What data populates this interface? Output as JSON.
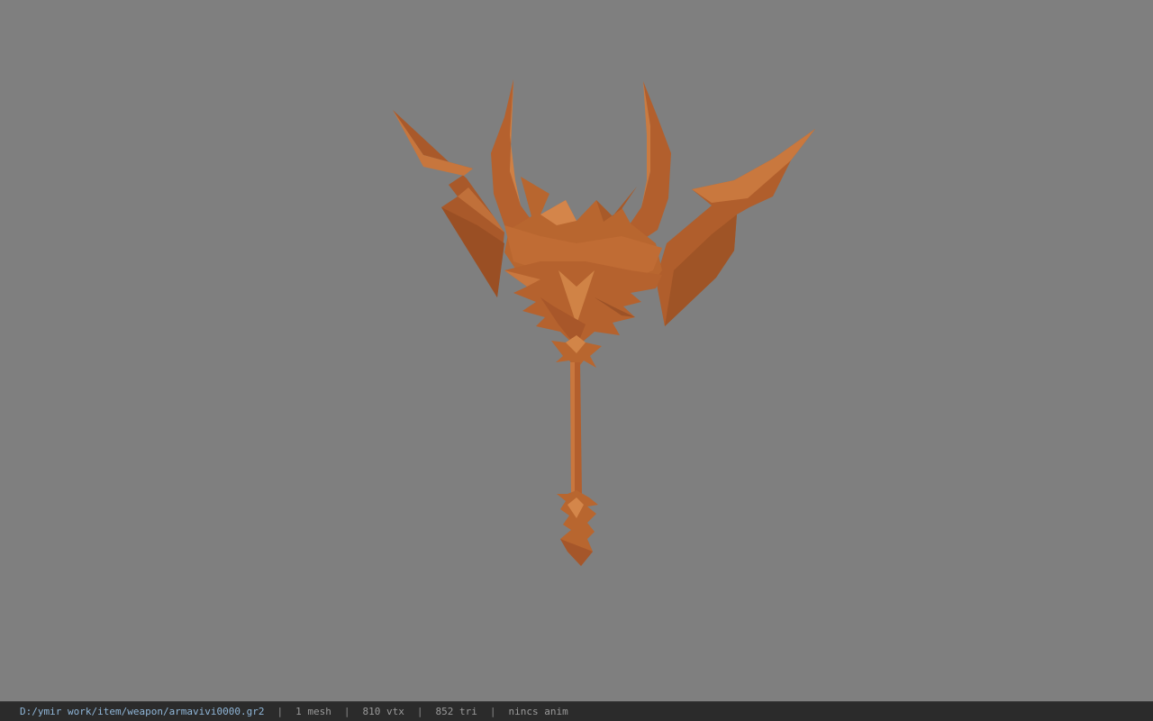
{
  "viewport": {
    "background_color": "#7f7f7f",
    "model": {
      "name": "weapon-model",
      "base_color": "#b8662f"
    }
  },
  "status_bar": {
    "file_path": "D:/ymir work/item/weapon/armavivi0000.gr2",
    "mesh_count": "1 mesh",
    "vertex_count": "810 vtx",
    "triangle_count": "852 tri",
    "anim_status": "nincs anim",
    "separator": "|"
  }
}
